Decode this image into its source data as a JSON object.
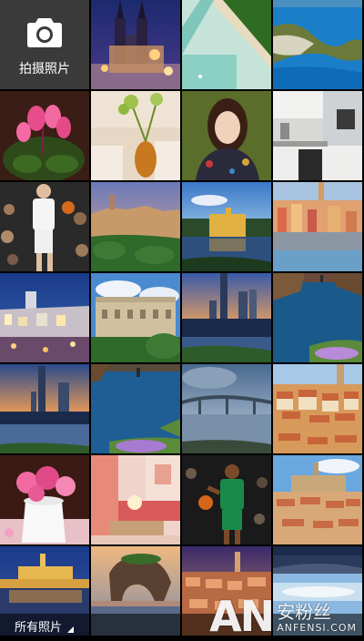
{
  "camera_tile": {
    "label": "拍摄照片",
    "icon": "camera-icon"
  },
  "album_selector": {
    "label": "所有照片",
    "icon": "dropdown-triangle-icon"
  },
  "watermark": {
    "logo": "AN",
    "chinese": "安粉丝",
    "english": "ANFENSI.COM"
  },
  "photos": [
    {
      "name": "photo-prague-church-night"
    },
    {
      "name": "photo-beach-aerial"
    },
    {
      "name": "photo-zakynthos-cove"
    },
    {
      "name": "photo-pink-cyclamen"
    },
    {
      "name": "photo-vase-sofa"
    },
    {
      "name": "photo-woman-portrait"
    },
    {
      "name": "photo-modern-kitchen"
    },
    {
      "name": "photo-basketball-player-white"
    },
    {
      "name": "photo-hilltop-village"
    },
    {
      "name": "photo-castle-river-sunset"
    },
    {
      "name": "photo-coastal-town"
    },
    {
      "name": "photo-city-night-bay"
    },
    {
      "name": "photo-palace-cloudy-sky"
    },
    {
      "name": "photo-city-skyline-dusk"
    },
    {
      "name": "photo-fjord-cliffs"
    },
    {
      "name": "photo-skyline-river-dusk"
    },
    {
      "name": "photo-sea-rock-island"
    },
    {
      "name": "photo-bridge-river"
    },
    {
      "name": "photo-old-town-rooftops"
    },
    {
      "name": "photo-peonies-white-vase"
    },
    {
      "name": "photo-pink-living-room"
    },
    {
      "name": "photo-basketball-player-green"
    },
    {
      "name": "photo-cathedral-town"
    },
    {
      "name": "photo-cordoba-night"
    },
    {
      "name": "photo-rock-arch-sunset"
    },
    {
      "name": "photo-verona-aerial"
    },
    {
      "name": "photo-lake-mountains"
    }
  ]
}
